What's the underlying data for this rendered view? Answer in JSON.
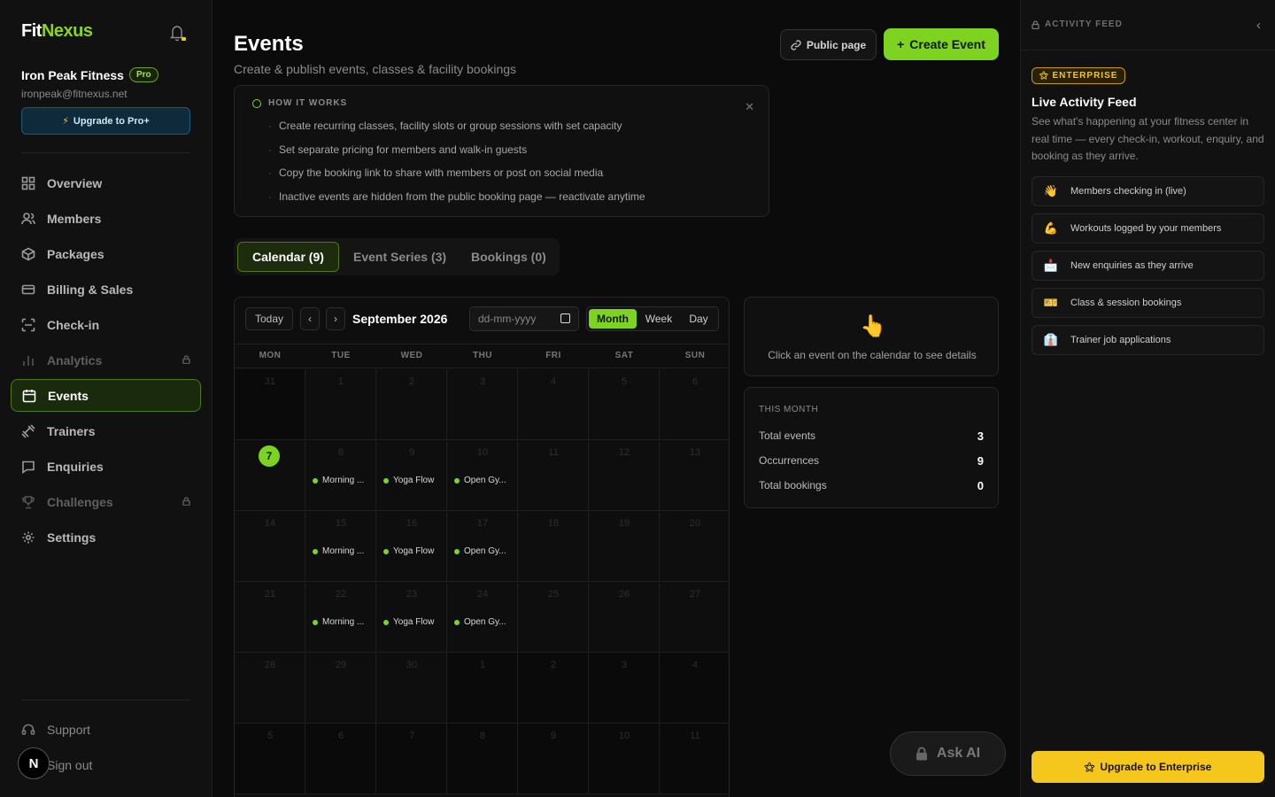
{
  "brand": {
    "part1": "Fit",
    "part2": "Nexus"
  },
  "org": {
    "name": "Iron Peak Fitness",
    "plan_badge": "Pro",
    "email": "ironpeak@fitnexus.net"
  },
  "upgrade_pro_label": "Upgrade to Pro+",
  "nav": [
    {
      "label": "Overview",
      "icon": "grid-icon",
      "locked": false,
      "active": false
    },
    {
      "label": "Members",
      "icon": "users-icon",
      "locked": false,
      "active": false
    },
    {
      "label": "Packages",
      "icon": "box-icon",
      "locked": false,
      "active": false
    },
    {
      "label": "Billing & Sales",
      "icon": "card-icon",
      "locked": false,
      "active": false
    },
    {
      "label": "Check-in",
      "icon": "scan-icon",
      "locked": false,
      "active": false
    },
    {
      "label": "Analytics",
      "icon": "bar-chart-icon",
      "locked": true,
      "active": false
    },
    {
      "label": "Events",
      "icon": "calendar-icon",
      "locked": false,
      "active": true
    },
    {
      "label": "Trainers",
      "icon": "dumbbell-icon",
      "locked": false,
      "active": false
    },
    {
      "label": "Enquiries",
      "icon": "message-icon",
      "locked": false,
      "active": false
    },
    {
      "label": "Challenges",
      "icon": "trophy-icon",
      "locked": true,
      "active": false
    },
    {
      "label": "Settings",
      "icon": "gear-icon",
      "locked": false,
      "active": false
    }
  ],
  "bottom_nav": {
    "support": "Support",
    "signout": "Sign out",
    "avatar_letter": "N"
  },
  "page": {
    "title": "Events",
    "subtitle": "Create & publish events, classes & facility bookings"
  },
  "actions": {
    "public_page": "Public page",
    "create_event": "Create Event"
  },
  "how_it_works": {
    "heading": "HOW IT WORKS",
    "items": [
      "Create recurring classes, facility slots or group sessions with set capacity",
      "Set separate pricing for members and walk-in guests",
      "Copy the booking link to share with members or post on social media",
      "Inactive events are hidden from the public booking page — reactivate anytime"
    ]
  },
  "tabs": [
    {
      "label": "Calendar (9)",
      "active": true
    },
    {
      "label": "Event Series (3)",
      "active": false
    },
    {
      "label": "Bookings (0)",
      "active": false
    }
  ],
  "calendar": {
    "today_label": "Today",
    "prev": "‹",
    "next": "›",
    "month_label": "September 2026",
    "date_placeholder": "dd-mm-yyyy",
    "views": [
      "Month",
      "Week",
      "Day"
    ],
    "active_view": "Month",
    "weekdays": [
      "MON",
      "TUE",
      "WED",
      "THU",
      "FRI",
      "SAT",
      "SUN"
    ],
    "weeks": [
      [
        {
          "d": "31",
          "out": true
        },
        {
          "d": "1"
        },
        {
          "d": "2"
        },
        {
          "d": "3"
        },
        {
          "d": "4"
        },
        {
          "d": "5"
        },
        {
          "d": "6"
        }
      ],
      [
        {
          "d": "7",
          "today": true
        },
        {
          "d": "8",
          "event": "Morning ..."
        },
        {
          "d": "9",
          "event": "Yoga Flow"
        },
        {
          "d": "10",
          "event": "Open Gy..."
        },
        {
          "d": "11"
        },
        {
          "d": "12"
        },
        {
          "d": "13"
        }
      ],
      [
        {
          "d": "14"
        },
        {
          "d": "15",
          "event": "Morning ..."
        },
        {
          "d": "16",
          "event": "Yoga Flow"
        },
        {
          "d": "17",
          "event": "Open Gy..."
        },
        {
          "d": "18"
        },
        {
          "d": "19"
        },
        {
          "d": "20"
        }
      ],
      [
        {
          "d": "21"
        },
        {
          "d": "22",
          "event": "Morning ..."
        },
        {
          "d": "23",
          "event": "Yoga Flow"
        },
        {
          "d": "24",
          "event": "Open Gy..."
        },
        {
          "d": "25"
        },
        {
          "d": "26"
        },
        {
          "d": "27"
        }
      ],
      [
        {
          "d": "28"
        },
        {
          "d": "29"
        },
        {
          "d": "30"
        },
        {
          "d": "1",
          "out": true
        },
        {
          "d": "2",
          "out": true
        },
        {
          "d": "3",
          "out": true
        },
        {
          "d": "4",
          "out": true
        }
      ],
      [
        {
          "d": "5",
          "out": true
        },
        {
          "d": "6",
          "out": true
        },
        {
          "d": "7",
          "out": true
        },
        {
          "d": "8",
          "out": true
        },
        {
          "d": "9",
          "out": true
        },
        {
          "d": "10",
          "out": true
        },
        {
          "d": "11",
          "out": true
        }
      ]
    ]
  },
  "detail_hint": "Click an event on the calendar to see details",
  "this_month": {
    "heading": "THIS MONTH",
    "stats": [
      {
        "label": "Total events",
        "value": "3"
      },
      {
        "label": "Occurrences",
        "value": "9"
      },
      {
        "label": "Total bookings",
        "value": "0"
      }
    ]
  },
  "ask_ai": "Ask AI",
  "feed": {
    "top_label": "ACTIVITY FEED",
    "badge": "ENTERPRISE",
    "title": "Live Activity Feed",
    "description": "See what's happening at your fitness center in real time — every check-in, workout, enquiry, and booking as they arrive.",
    "items": [
      {
        "emoji": "👋",
        "label": "Members checking in (live)"
      },
      {
        "emoji": "💪",
        "label": "Workouts logged by your members"
      },
      {
        "emoji": "📩",
        "label": "New enquiries as they arrive"
      },
      {
        "emoji": "🎫",
        "label": "Class & session bookings"
      },
      {
        "emoji": "👔",
        "label": "Trainer job applications"
      }
    ],
    "upgrade_label": "Upgrade to Enterprise"
  },
  "colors": {
    "accent": "#7ed321",
    "enterprise": "#f5c61b",
    "background": "#0b0b0b"
  }
}
